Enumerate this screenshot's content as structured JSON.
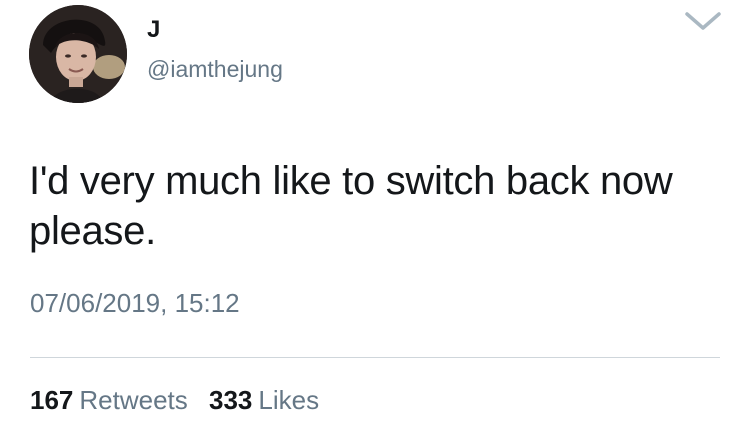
{
  "tweet": {
    "display_name": "J",
    "handle": "@iamthejung",
    "text": "I'd very much like to switch back now please.",
    "timestamp": "07/06/2019, 15:12",
    "stats": {
      "retweets_count": "167",
      "retweets_label": "Retweets",
      "likes_count": "333",
      "likes_label": "Likes"
    }
  },
  "icons": {
    "menu": "chevron-down-icon"
  },
  "colors": {
    "primary_text": "#14171a",
    "secondary_text": "#657786",
    "divider": "#cfd6db",
    "background": "#ffffff"
  }
}
